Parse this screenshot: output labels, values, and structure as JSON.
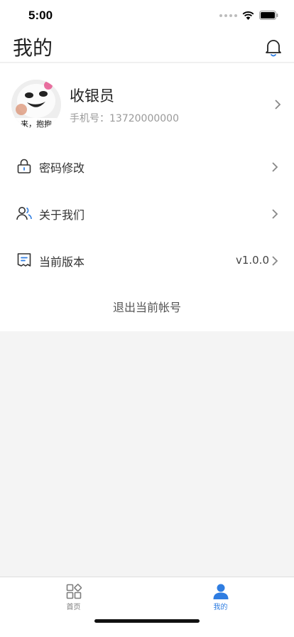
{
  "status_bar": {
    "time": "5:00"
  },
  "header": {
    "title": "我的",
    "notification_icon": "bell-icon"
  },
  "profile": {
    "name": "收银员",
    "phone": "手机号：13720000000",
    "avatar_caption": "来，抱抱"
  },
  "menu": {
    "items": [
      {
        "label": "密码修改",
        "icon": "lock-icon",
        "value": ""
      },
      {
        "label": "关于我们",
        "icon": "users-icon",
        "value": ""
      },
      {
        "label": "当前版本",
        "icon": "receipt-icon",
        "value": "v1.0.0"
      }
    ]
  },
  "logout_label": "退出当前帐号",
  "tabbar": {
    "tabs": [
      {
        "label": "首页",
        "icon": "grid-icon",
        "active": false
      },
      {
        "label": "我的",
        "icon": "person-icon",
        "active": true
      }
    ]
  },
  "colors": {
    "accent": "#2f7de1",
    "background": "#f4f4f4",
    "inactive_tab": "#7d7d7d"
  }
}
